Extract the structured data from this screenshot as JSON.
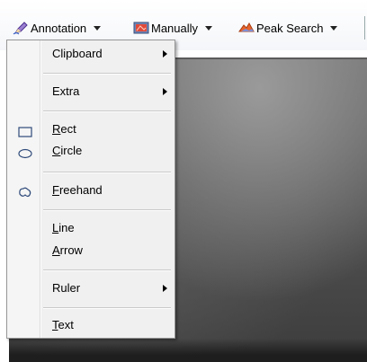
{
  "toolbar": {
    "annotation": {
      "label": "Annotation",
      "icon": "annotation-pen-icon"
    },
    "manually": {
      "label": "Manually",
      "icon": "manual-image-icon"
    },
    "peak_search": {
      "label": "Peak Search",
      "icon": "peak-search-icon"
    }
  },
  "menu": {
    "items": [
      {
        "label": "Clipboard",
        "underline": "",
        "rest": "Clipboard",
        "submenu": true
      },
      {
        "label": "Extra",
        "underline": "",
        "rest": "Extra",
        "submenu": true
      },
      {
        "label": "Rect",
        "underline": "R",
        "rest": "ect",
        "icon": "rectangle-icon"
      },
      {
        "label": "Circle",
        "underline": "C",
        "rest": "ircle",
        "icon": "ellipse-icon"
      },
      {
        "label": "Freehand",
        "underline": "F",
        "rest": "reehand",
        "icon": "freehand-icon"
      },
      {
        "label": "Line",
        "underline": "L",
        "rest": "ine"
      },
      {
        "label": "Arrow",
        "underline": "A",
        "rest": "rrow"
      },
      {
        "label": "Ruler",
        "underline": "",
        "rest": "Ruler",
        "submenu": true
      },
      {
        "label": "Text",
        "underline": "T",
        "rest": "ext"
      }
    ]
  },
  "colors": {
    "menu_bg": "#f0f0f0",
    "menu_border": "#979797",
    "image_bg": "#5a5a5a"
  }
}
